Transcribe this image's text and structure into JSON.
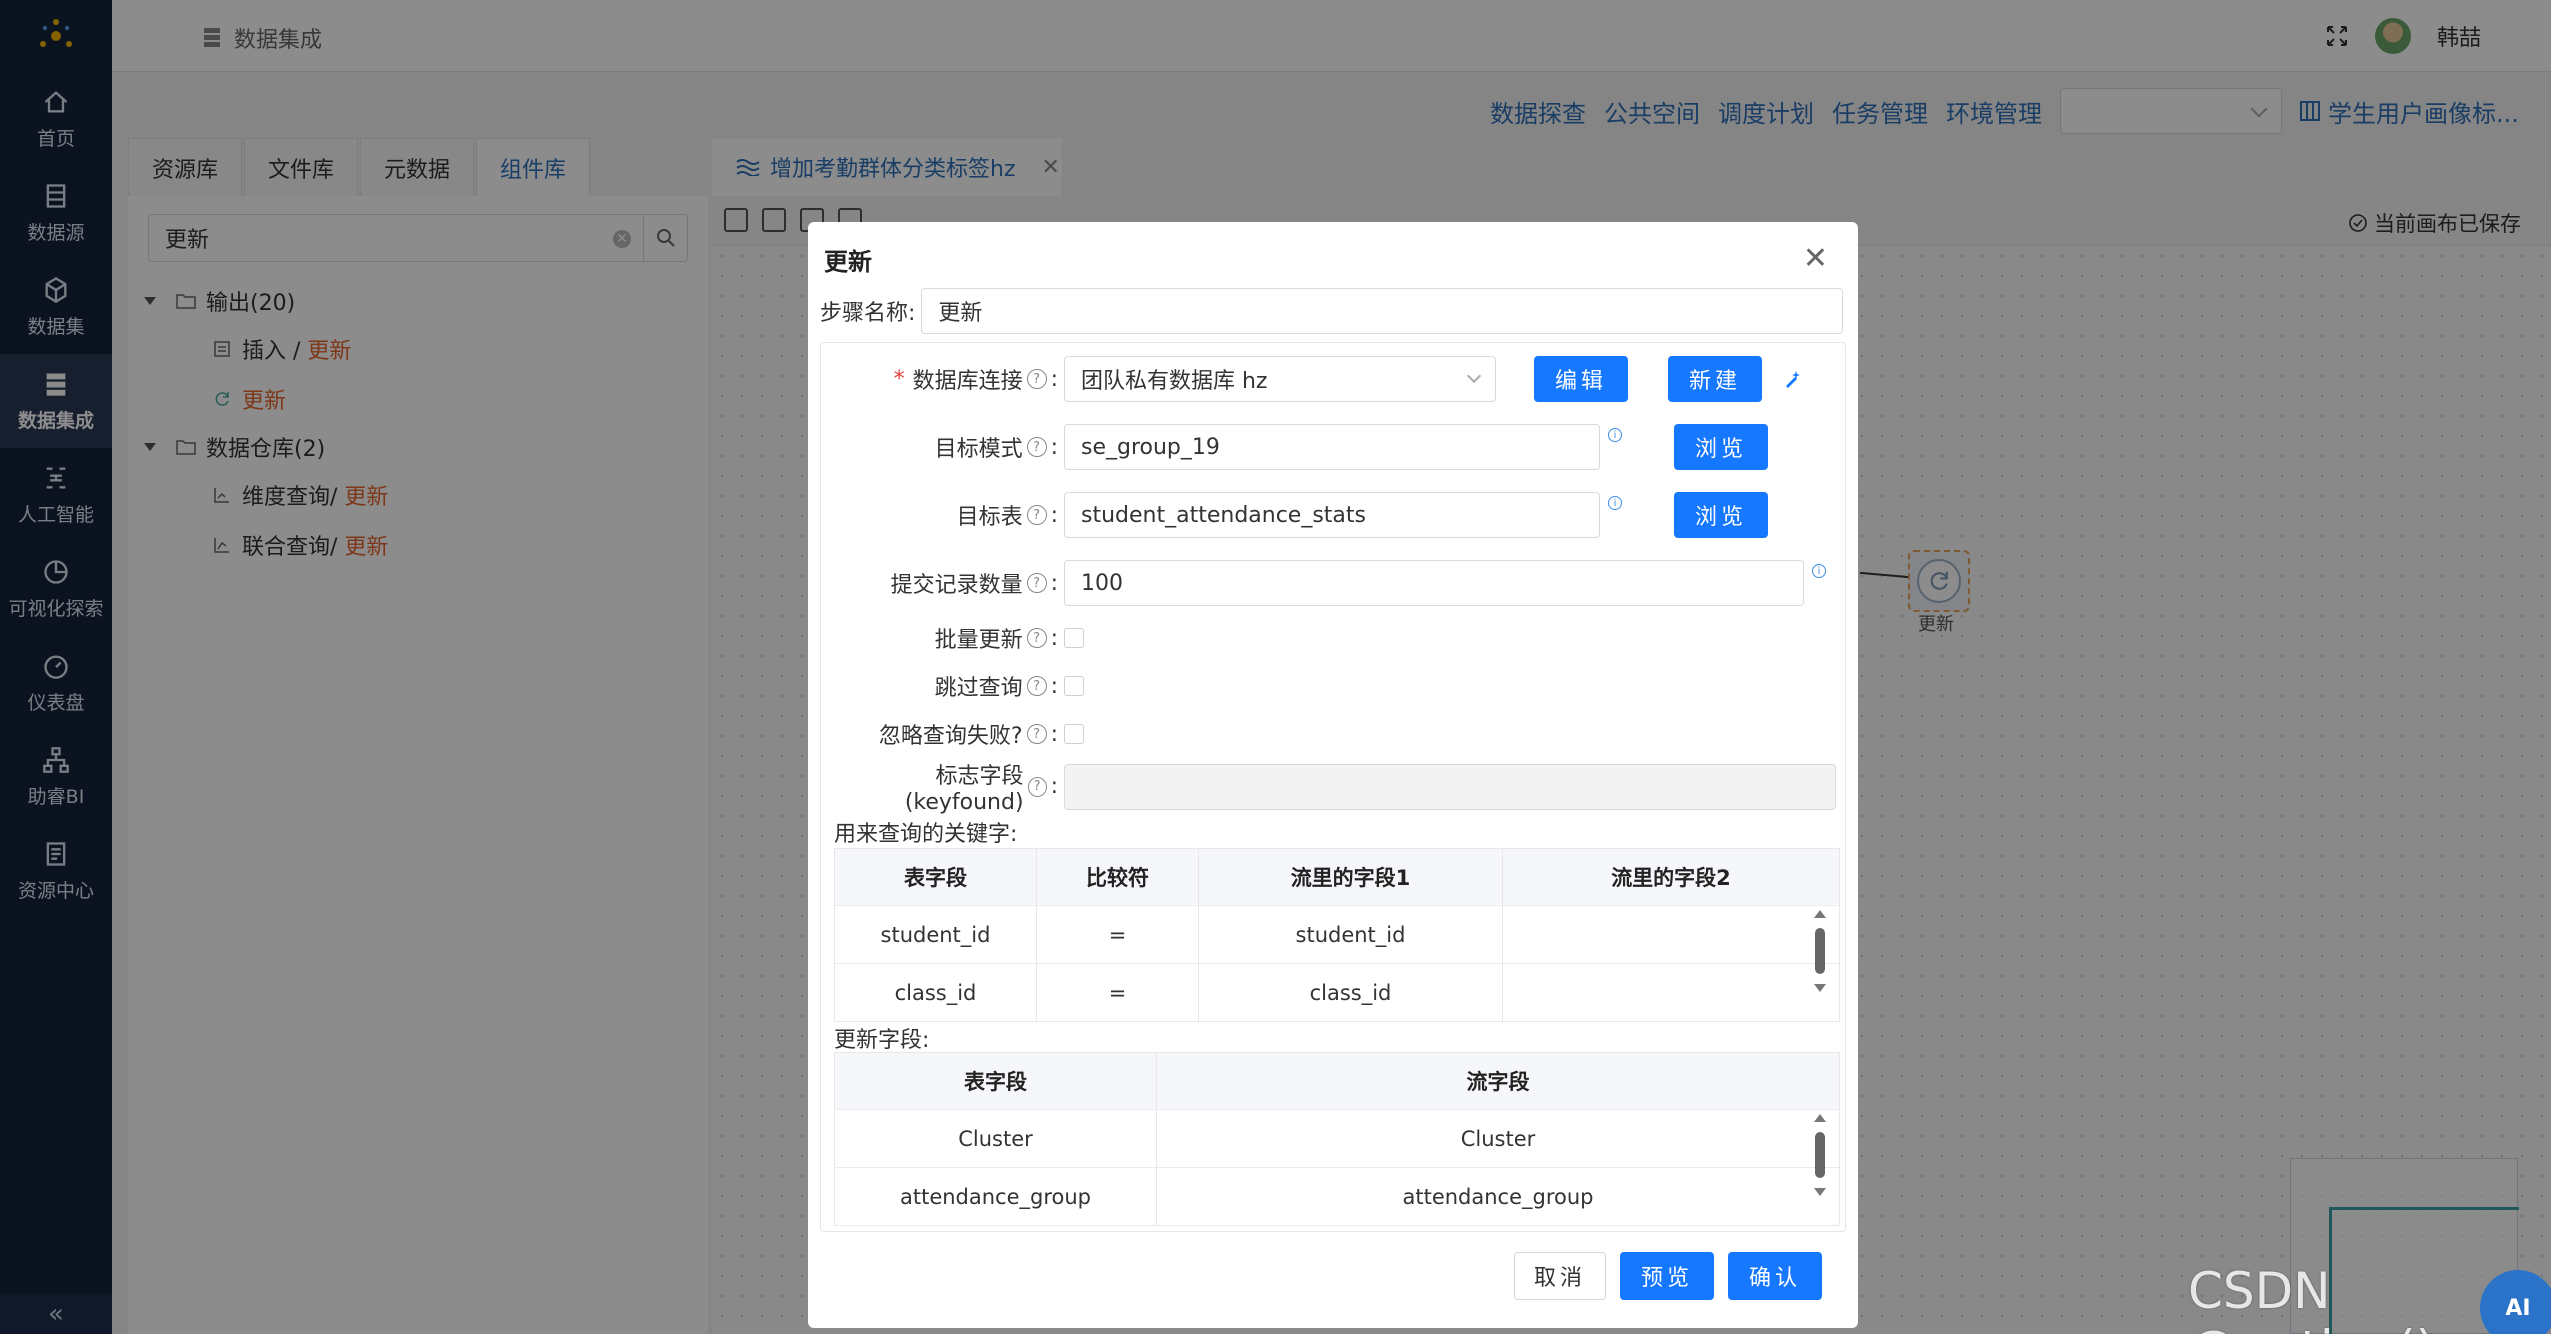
{
  "sidebar": {
    "items": [
      {
        "label": "首页",
        "icon": "home-icon"
      },
      {
        "label": "数据源",
        "icon": "database-icon"
      },
      {
        "label": "数据集",
        "icon": "cube-icon"
      },
      {
        "label": "数据集成",
        "icon": "server-icon",
        "active": true
      },
      {
        "label": "人工智能",
        "icon": "ai-icon"
      },
      {
        "label": "可视化探索",
        "icon": "pie-chart-icon"
      },
      {
        "label": "仪表盘",
        "icon": "gauge-icon"
      },
      {
        "label": "助睿BI",
        "icon": "org-chart-icon"
      },
      {
        "label": "资源中心",
        "icon": "document-icon"
      }
    ],
    "collapse_label": "«"
  },
  "topbar": {
    "breadcrumb": "数据集成",
    "user_name": "韩喆"
  },
  "menu": {
    "items": [
      "数据探查",
      "公共空间",
      "调度计划",
      "任务管理",
      "环境管理"
    ],
    "profile_label": "学生用户画像标..."
  },
  "left_panel": {
    "tabs": [
      "资源库",
      "文件库",
      "元数据",
      "组件库"
    ],
    "active_tab": 3,
    "search_value": "更新",
    "tree": {
      "group1": {
        "label": "输出(20)",
        "children": [
          {
            "prefix": "插入 / ",
            "highlight": "更新"
          },
          {
            "prefix": "",
            "highlight": "更新"
          }
        ]
      },
      "group2": {
        "label": "数据仓库(2)",
        "children": [
          {
            "prefix": "维度查询/ ",
            "highlight": "更新"
          },
          {
            "prefix": "联合查询/ ",
            "highlight": "更新"
          }
        ]
      }
    }
  },
  "editor": {
    "tab_title": "增加考勤群体分类标签hz",
    "saved_status": "当前画布已保存",
    "node_label": "更新"
  },
  "dialog": {
    "title": "更新",
    "step_name_label": "步骤名称:",
    "step_name_value": "更新",
    "db_conn_label": "数据库连接",
    "db_conn_value": "团队私有数据库 hz",
    "edit_button": "编辑",
    "new_button": "新建",
    "target_schema_label": "目标模式",
    "target_schema_value": "se_group_19",
    "browse_button": "浏览",
    "target_table_label": "目标表",
    "target_table_value": "student_attendance_stats",
    "commit_label": "提交记录数量",
    "commit_value": "100",
    "batch_update_label": "批量更新",
    "skip_lookup_label": "跳过查询",
    "ignore_fail_label": "忽略查询失败?",
    "keyfound_label": "标志字段(keyfound)",
    "keyfound_value": "",
    "colon": ":",
    "lookup_section_label": "用来查询的关键字:",
    "lookup_table": {
      "headers": [
        "表字段",
        "比较符",
        "流里的字段1",
        "流里的字段2"
      ],
      "rows": [
        [
          "student_id",
          "=",
          "student_id",
          ""
        ],
        [
          "class_id",
          "=",
          "class_id",
          ""
        ]
      ]
    },
    "update_section_label": "更新字段:",
    "update_table": {
      "headers": [
        "表字段",
        "流字段"
      ],
      "rows": [
        [
          "Cluster",
          "Cluster"
        ],
        [
          "attendance_group",
          "attendance_group"
        ]
      ]
    },
    "cancel_button": "取消",
    "preview_button": "预览",
    "confirm_button": "确认"
  },
  "watermark": "CSDN @potion()",
  "ai_badge": "AI",
  "colors": {
    "sidebar_bg": "#14233d",
    "primary": "#1677ff",
    "link": "#2f6fb8",
    "highlight": "#e5642f"
  }
}
